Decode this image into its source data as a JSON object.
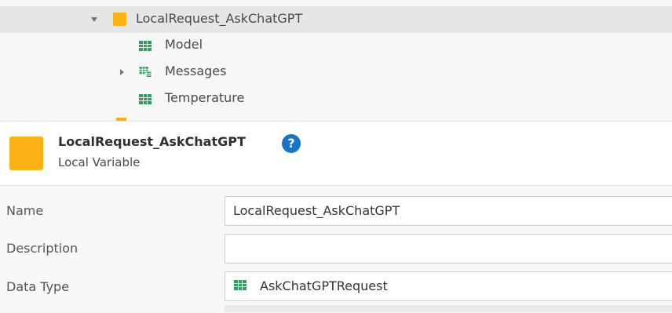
{
  "tree": {
    "root": {
      "label": "LocalRequest_AskChatGPT",
      "expanded": true
    },
    "children": [
      {
        "label": "Model",
        "icon": "attribute-grid-icon"
      },
      {
        "label": "Messages",
        "icon": "list-grid-icon",
        "expandable": true
      },
      {
        "label": "Temperature",
        "icon": "attribute-grid-icon"
      }
    ]
  },
  "header": {
    "name": "LocalRequest_AskChatGPT",
    "kind": "Local Variable",
    "help_icon": "?",
    "icon_color": "#fcb215"
  },
  "properties": {
    "name": {
      "label": "Name",
      "value": "LocalRequest_AskChatGPT"
    },
    "description": {
      "label": "Description",
      "value": ""
    },
    "data_type": {
      "label": "Data Type",
      "value": "AskChatGPTRequest",
      "icon": "structure-grid-icon"
    }
  },
  "colors": {
    "accent": "#fcb215",
    "help": "#1774c7",
    "grid_icon": "#27a05a"
  }
}
